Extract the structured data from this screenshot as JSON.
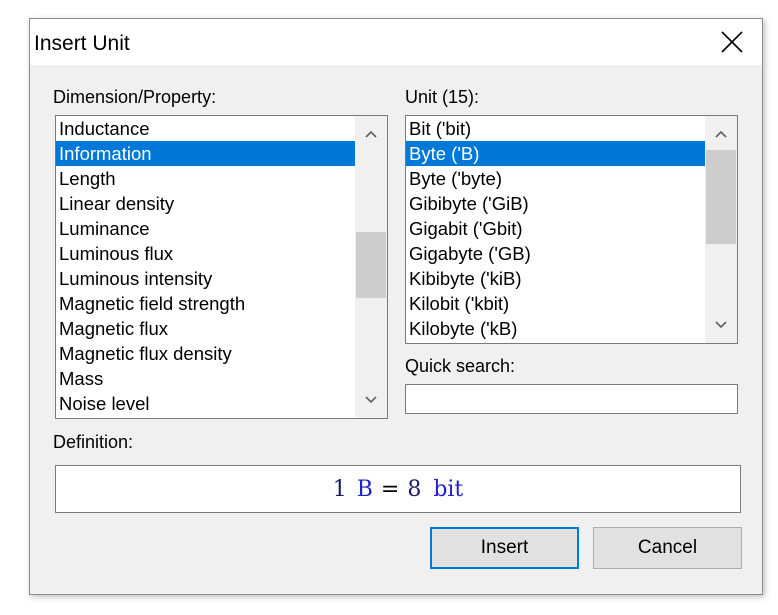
{
  "window": {
    "title": "Insert Unit",
    "close_icon": "close-icon"
  },
  "dimension": {
    "label": "Dimension/Property:",
    "items": [
      "Inductance",
      "Information",
      "Length",
      "Linear density",
      "Luminance",
      "Luminous flux",
      "Luminous intensity",
      "Magnetic field strength",
      "Magnetic flux",
      "Magnetic flux density",
      "Mass",
      "Noise level"
    ],
    "selected": "Information"
  },
  "unit": {
    "label": "Unit (15):",
    "items": [
      "Bit ('bit)",
      "Byte ('B)",
      "Byte ('byte)",
      "Gibibyte ('GiB)",
      "Gigabit ('Gbit)",
      "Gigabyte ('GB)",
      "Kibibyte ('kiB)",
      "Kilobit ('kbit)",
      "Kilobyte ('kB)"
    ],
    "selected": "Byte ('B)"
  },
  "quick_search": {
    "label": "Quick search:",
    "value": ""
  },
  "definition": {
    "label": "Definition:",
    "lhs_number": "1",
    "lhs_unit": "B",
    "equals": "=",
    "rhs_number": "8",
    "rhs_unit": "bit"
  },
  "buttons": {
    "insert": "Insert",
    "cancel": "Cancel"
  },
  "colors": {
    "selection": "#0078d7",
    "unit_text": "#2222cc"
  }
}
